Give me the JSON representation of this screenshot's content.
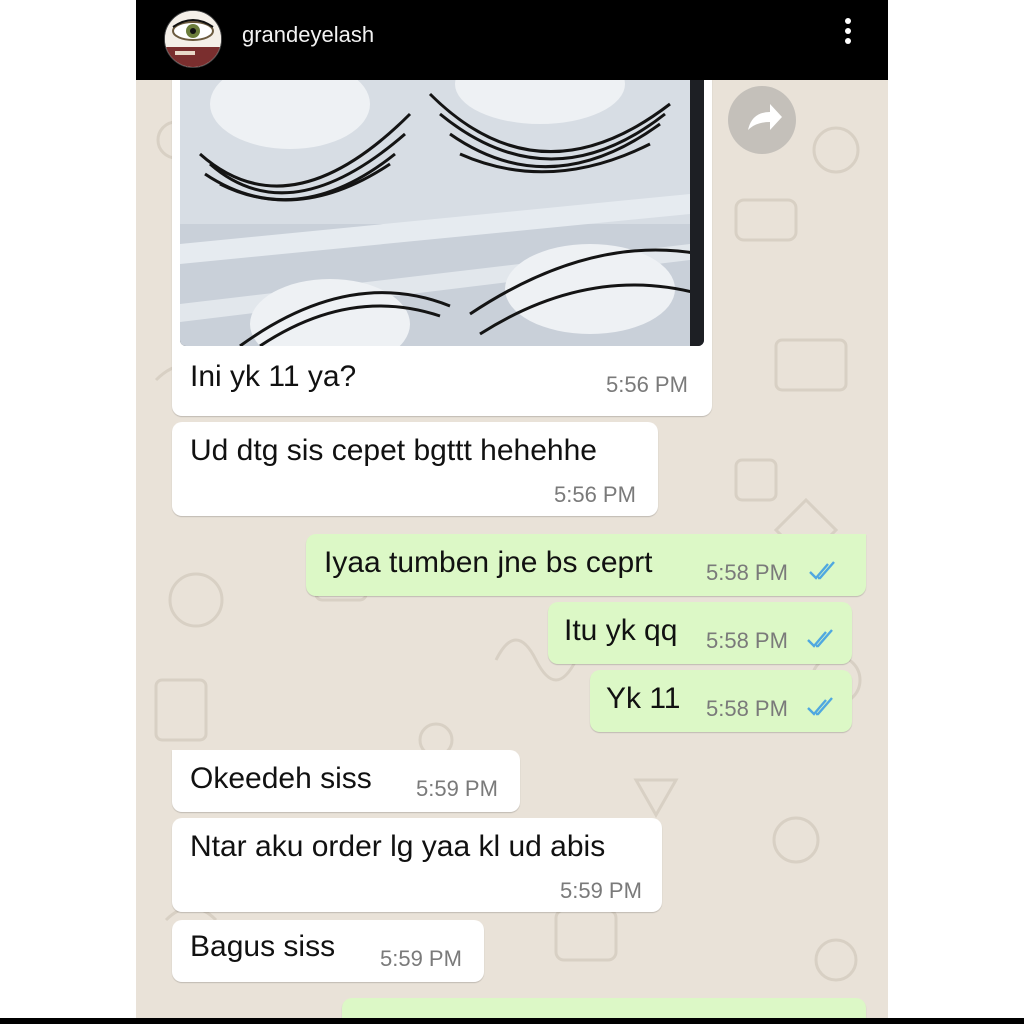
{
  "header": {
    "username": "grandeyelash",
    "avatar_icon": "eye-logo-icon",
    "menu_icon": "more-vertical-icon"
  },
  "colors": {
    "incoming_bubble": "#ffffff",
    "outgoing_bubble": "#dcf8c6",
    "wallpaper": "#e9e2d8",
    "read_ticks": "#4fa8e0"
  },
  "image_message": {
    "image_icon": "false-eyelashes-photo",
    "text": "Ini yk 11 ya?",
    "time": "5:56 PM"
  },
  "messages": [
    {
      "direction": "in",
      "text": "Ud dtg sis cepet bgttt hehehhe",
      "time": "5:56 PM"
    },
    {
      "direction": "out",
      "text": "Iyaa tumben jne bs ceprt",
      "time": "5:58 PM",
      "status_icon": "double-check-icon"
    },
    {
      "direction": "out",
      "text": "Itu yk qq",
      "time": "5:58 PM",
      "status_icon": "double-check-icon"
    },
    {
      "direction": "out",
      "text": "Yk 11",
      "time": "5:58 PM",
      "status_icon": "double-check-icon"
    },
    {
      "direction": "in",
      "text": "Okeedeh siss",
      "time": "5:59 PM"
    },
    {
      "direction": "in",
      "text": "Ntar aku order lg yaa kl ud abis",
      "time": "5:59 PM"
    },
    {
      "direction": "in",
      "text": "Bagus siss",
      "time": "5:59 PM"
    }
  ],
  "forward_icon": "forward-arrow-icon"
}
